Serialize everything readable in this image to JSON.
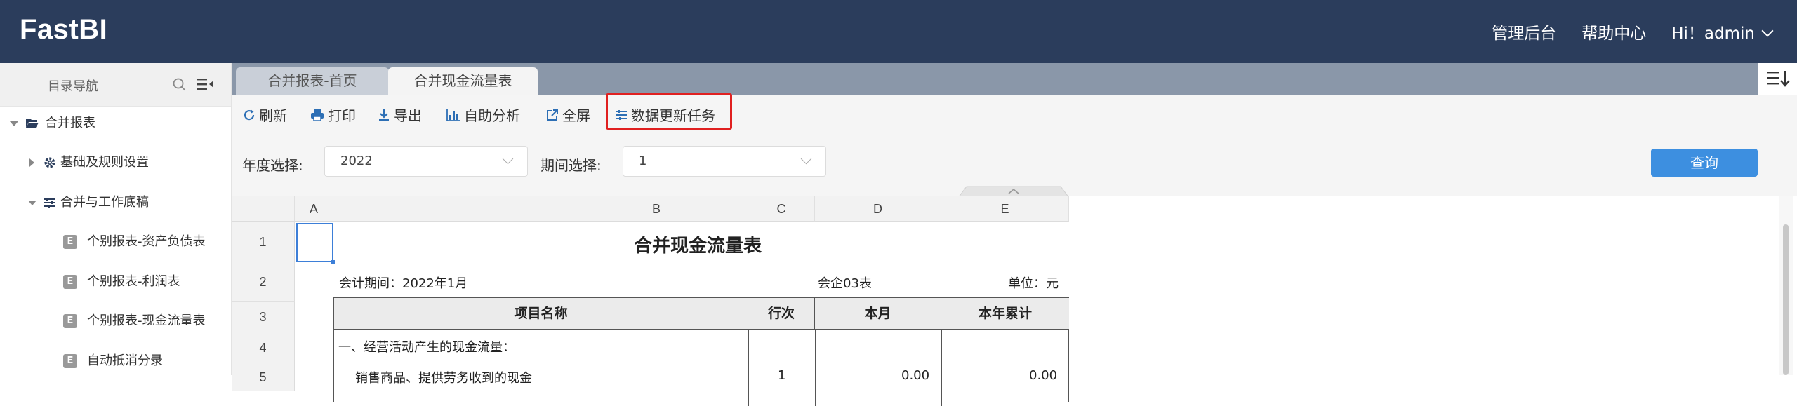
{
  "app": {
    "logo": "FastBI"
  },
  "topnav": {
    "admin_console": "管理后台",
    "help_center": "帮助中心",
    "user_greeting": "Hi！admin"
  },
  "sidebar": {
    "title": "目录导航",
    "tree": [
      {
        "label": "合并报表",
        "icon": "folder-open-icon"
      },
      {
        "label": "基础及规则设置",
        "icon": "gear-icon"
      },
      {
        "label": "合并与工作底稿",
        "icon": "sliders-icon"
      },
      {
        "label": "个别报表-资产负债表",
        "badge": "E"
      },
      {
        "label": "个别报表-利润表",
        "badge": "E"
      },
      {
        "label": "个别报表-现金流量表",
        "badge": "E"
      },
      {
        "label": "自动抵消分录",
        "badge": "E"
      }
    ]
  },
  "tabs": [
    {
      "label": "合并报表-首页"
    },
    {
      "label": "合并现金流量表"
    }
  ],
  "toolbar": {
    "refresh": "刷新",
    "print": "打印",
    "export": "导出",
    "analysis": "自助分析",
    "fullscreen": "全屏",
    "data_update_task": "数据更新任务"
  },
  "filters": {
    "year_label": "年度选择:",
    "year_value": "2022",
    "period_label": "期间选择:",
    "period_value": "1",
    "query_button": "查询"
  },
  "sheet": {
    "columns": [
      "A",
      "B",
      "C",
      "D",
      "E"
    ],
    "rows": [
      "1",
      "2",
      "3",
      "4",
      "5"
    ],
    "title": "合并现金流量表",
    "period": "会计期间：2022年1月",
    "form_no": "会企03表",
    "unit": "单位：元",
    "headers": [
      "项目名称",
      "行次",
      "本月",
      "本年累计"
    ],
    "row4_item": "一、经营活动产生的现金流量：",
    "row5_item": "销售商品、提供劳务收到的现金",
    "row5_line": "1",
    "row5_month": "0.00",
    "row5_ytd": "0.00"
  },
  "colors": {
    "topbar": "#2b3d5c",
    "tabbar": "#8a97a9",
    "primary": "#3d8fe0",
    "highlight": "#e02020"
  }
}
